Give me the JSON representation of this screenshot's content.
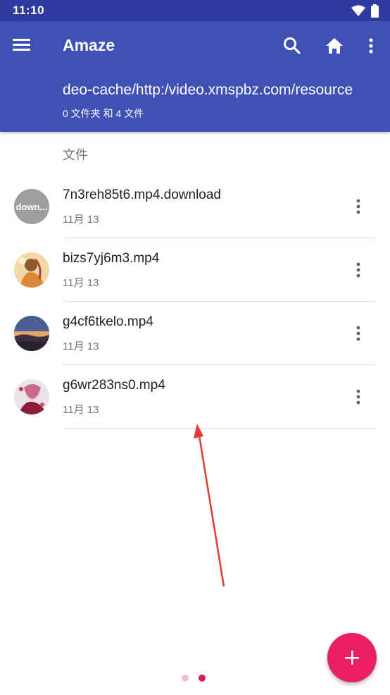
{
  "status_bar": {
    "time": "11:10"
  },
  "toolbar": {
    "title": "Amaze",
    "path": "deo-cache/http:/video.xmspbz.com/resource",
    "summary": "0 文件夹 和 4 文件"
  },
  "section": {
    "label": "文件"
  },
  "files": [
    {
      "name": "7n3reh85t6.mp4.download",
      "date": "11月 13",
      "thumb_text": "down...",
      "thumb": "generic"
    },
    {
      "name": "bizs7yj6m3.mp4",
      "date": "11月 13",
      "thumb_text": "",
      "thumb": "video-portrait"
    },
    {
      "name": "g4cf6tkelo.mp4",
      "date": "11月 13",
      "thumb_text": "",
      "thumb": "video-sunset"
    },
    {
      "name": "g6wr283ns0.mp4",
      "date": "11月 13",
      "thumb_text": "",
      "thumb": "video-anime"
    }
  ],
  "colors": {
    "status_bar": "#2f3b9e",
    "app_bar": "#3f51b5",
    "fab": "#e91e63",
    "page_dot_inactive": "#f8bbd0",
    "page_dot_active": "#d81b60",
    "annotation_arrow": "#e53935"
  },
  "pager": {
    "pages": 2,
    "active": 2
  }
}
